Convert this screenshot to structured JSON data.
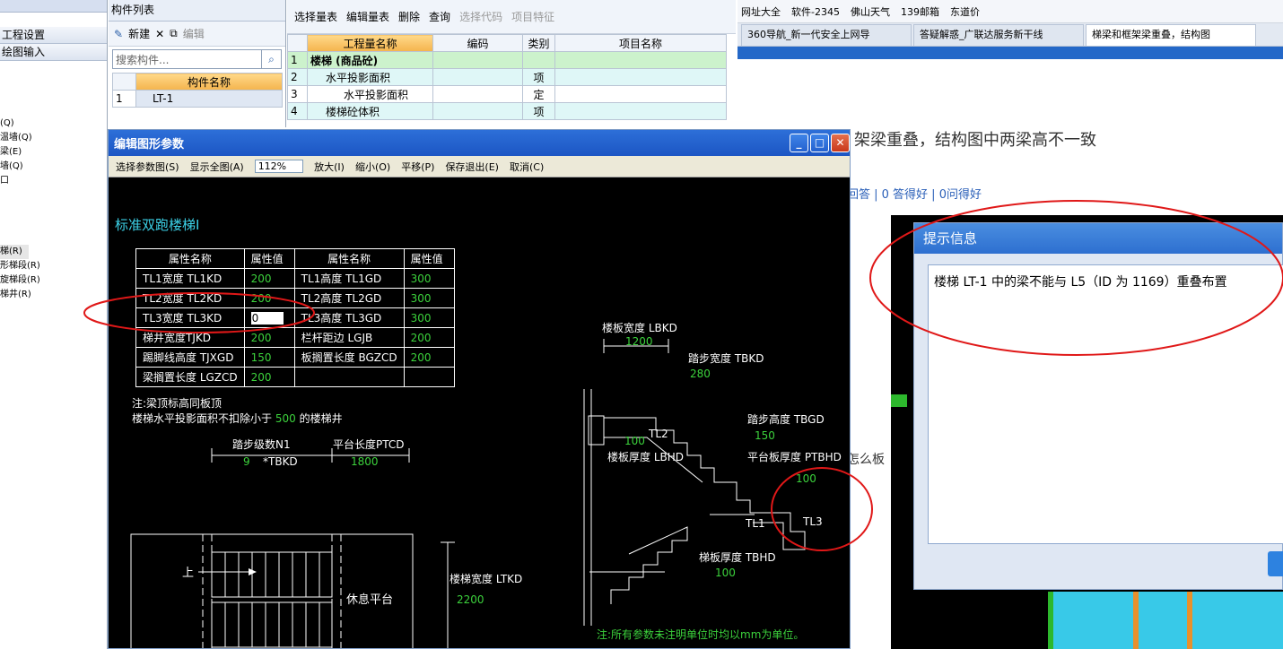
{
  "left_panel": {
    "items": [
      "工程设置",
      "绘图输入"
    ],
    "list": [
      "(Q)",
      "温墙(Q)",
      "梁(E)",
      "墙(Q)",
      "口",
      "梯(R)",
      "形梯段(R)",
      "旋梯段(R)",
      "梯井(R)"
    ]
  },
  "component_list": {
    "title": "构件列表",
    "new_label": "新建",
    "edit_label": "编辑",
    "search_placeholder": "搜索构件...",
    "header": "构件名称",
    "rows": [
      {
        "no": "1",
        "name": "LT-1"
      }
    ]
  },
  "quantity_table": {
    "toolbar": {
      "select": "选择量表",
      "edit": "编辑量表",
      "delete": "删除",
      "query": "查询",
      "select_code": "选择代码",
      "item_feature": "项目特征"
    },
    "headers": [
      "工程量名称",
      "编码",
      "类别",
      "项目名称"
    ],
    "rows": [
      {
        "no": "1",
        "name": "楼梯 (商品砼)",
        "code": "",
        "type": "",
        "item": ""
      },
      {
        "no": "2",
        "name": "水平投影面积",
        "code": "",
        "type": "项",
        "item": ""
      },
      {
        "no": "3",
        "name": "水平投影面积",
        "code": "",
        "type": "定",
        "item": ""
      },
      {
        "no": "4",
        "name": "楼梯砼体积",
        "code": "",
        "type": "项",
        "item": ""
      }
    ]
  },
  "browser": {
    "favorites": [
      "网址大全",
      "软件-2345",
      "佛山天气",
      "139邮箱",
      "东道价"
    ],
    "tabs": [
      "360导航_新一代安全上网导",
      "答疑解惑_广联达服务新干线",
      "梯梁和框架梁重叠，结构图"
    ],
    "question_title": "架梁重叠，结构图中两梁高不一致",
    "stats": "回答 | 0 答得好 | 0问得好",
    "side_text": "怎么板"
  },
  "dialog": {
    "title": "编辑图形参数",
    "menu": [
      "选择参数图(S)",
      "显示全图(A)",
      "112%",
      "放大(I)",
      "缩小(O)",
      "平移(P)",
      "保存退出(E)",
      "取消(C)"
    ],
    "drawing_title": "标准双跑楼梯Ⅰ",
    "table_headers": [
      "属性名称",
      "属性值",
      "属性名称",
      "属性值"
    ],
    "params": [
      [
        "TL1宽度 TL1KD",
        "200",
        "TL1高度 TL1GD",
        "300"
      ],
      [
        "TL2宽度 TL2KD",
        "200",
        "TL2高度 TL2GD",
        "300"
      ],
      [
        "TL3宽度 TL3KD",
        "0",
        "TL3高度 TL3GD",
        "300"
      ],
      [
        "梯井宽度TJKD",
        "200",
        "栏杆距边 LGJB",
        "200"
      ],
      [
        "踢脚线高度 TJXGD",
        "150",
        "板搁置长度 BGZCD",
        "200"
      ],
      [
        "梁搁置长度 LGZCD",
        "200",
        "",
        ""
      ]
    ],
    "note1": "注:梁顶标高同板顶",
    "note2_pre": "楼梯水平投影面积不扣除小于",
    "note2_val": "500",
    "note2_post": "的楼梯井",
    "plan": {
      "steps_label": "踏步级数N1",
      "steps_val": "9",
      "steps_mult": "*TBKD",
      "platform_label": "平台长度PTCD",
      "platform_val": "1800",
      "width_label": "楼梯宽度 LTKD",
      "width_val": "2200",
      "up": "上",
      "rest": "休息平台"
    },
    "section": {
      "lbkd_label": "楼板宽度 LBKD",
      "lbkd_val": "1200",
      "tbkd_label": "踏步宽度 TBKD",
      "tbkd_val": "280",
      "tbgd_label": "踏步高度 TBGD",
      "tbgd_val": "150",
      "lbhd_label": "楼板厚度 LBHD",
      "lbhd_val": "100",
      "ptbhd_label": "平台板厚度 PTBHD",
      "ptbhd_val": "100",
      "tbhd_label": "梯板厚度 TBHD",
      "tbhd_val": "100",
      "tl1": "TL1",
      "tl2": "TL2",
      "tl3": "TL3"
    },
    "bottom_note": "注:所有参数未注明单位时均以mm为单位。"
  },
  "hint": {
    "title": "提示信息",
    "message": "楼梯 LT-1 中的梁不能与 L5（ID 为 1169）重叠布置"
  }
}
